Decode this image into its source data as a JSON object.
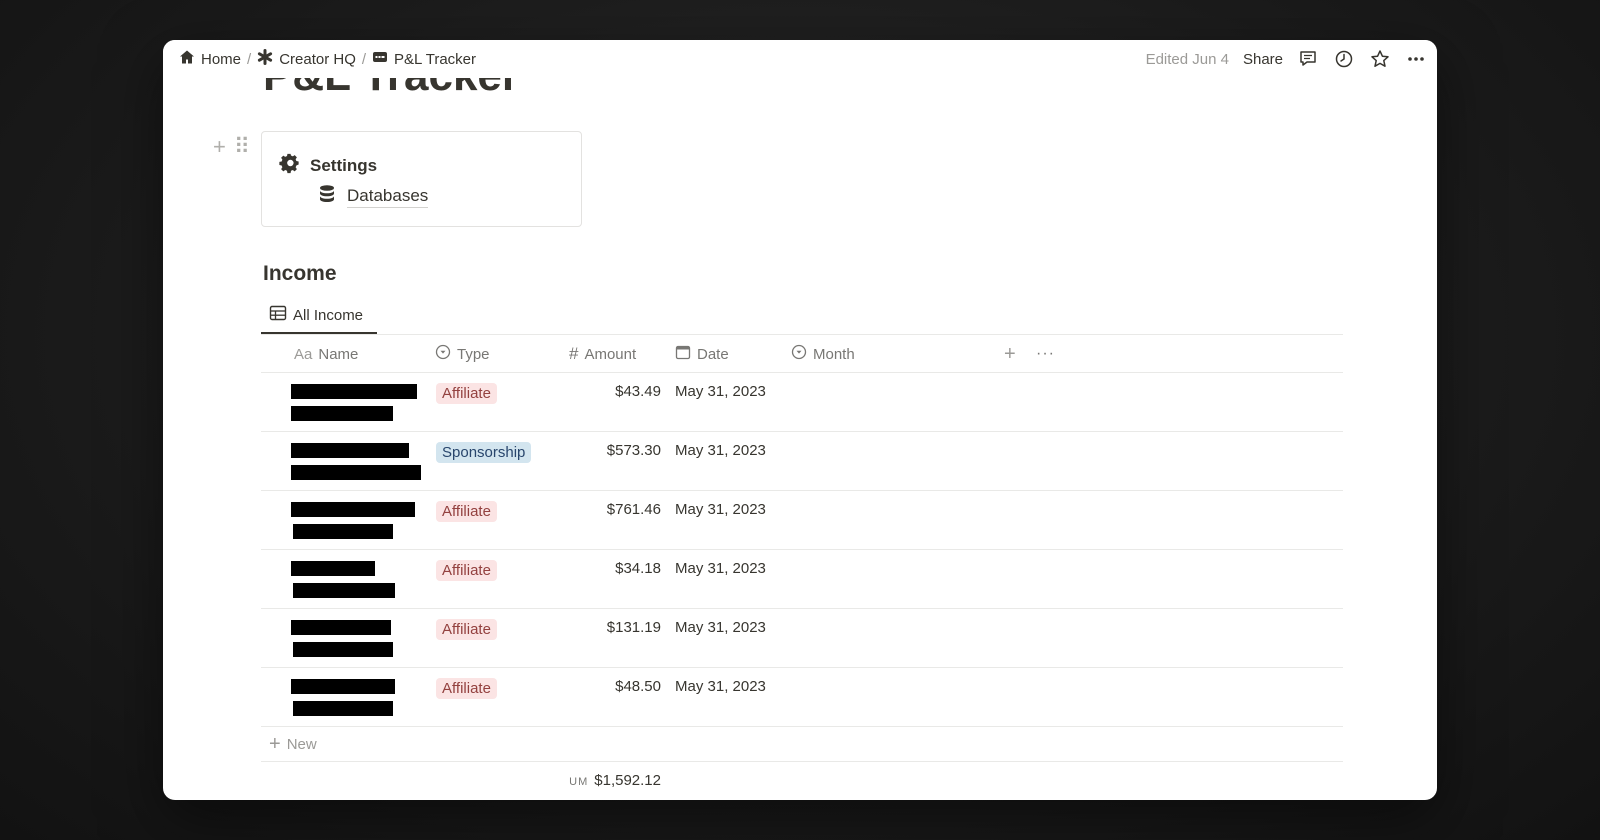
{
  "breadcrumb": {
    "items": [
      {
        "label": "Home",
        "icon": "home-icon"
      },
      {
        "label": "Creator HQ",
        "icon": "asterisk-icon"
      },
      {
        "label": "P&L Tracker",
        "icon": "id-card-icon"
      }
    ],
    "separator": "/"
  },
  "topbar": {
    "edited": "Edited Jun 4",
    "share": "Share",
    "icons": [
      "comment-icon",
      "clock-icon",
      "star-icon",
      "more-icon"
    ]
  },
  "page": {
    "title": "P&L Tracker"
  },
  "settings_card": {
    "title": "Settings",
    "link": "Databases"
  },
  "income": {
    "heading": "Income",
    "view_tab": "All Income",
    "columns": [
      {
        "label": "Name",
        "prefix": "Aa"
      },
      {
        "label": "Type",
        "icon": "select-icon"
      },
      {
        "label": "Amount",
        "prefix": "#"
      },
      {
        "label": "Date",
        "icon": "calendar-icon"
      },
      {
        "label": "Month",
        "icon": "select-icon"
      }
    ],
    "rows": [
      {
        "type": "Affiliate",
        "amount": "$43.49",
        "date": "May 31, 2023"
      },
      {
        "type": "Sponsorship",
        "amount": "$573.30",
        "date": "May 31, 2023"
      },
      {
        "type": "Affiliate",
        "amount": "$761.46",
        "date": "May 31, 2023"
      },
      {
        "type": "Affiliate",
        "amount": "$34.18",
        "date": "May 31, 2023"
      },
      {
        "type": "Affiliate",
        "amount": "$131.19",
        "date": "May 31, 2023"
      },
      {
        "type": "Affiliate",
        "amount": "$48.50",
        "date": "May 31, 2023"
      }
    ],
    "new_label": "New",
    "sum_label": "UM",
    "sum_value": "$1,592.12"
  },
  "colors": {
    "affiliate_bg": "#fbe4e4",
    "sponsorship_bg": "#d3e5ef",
    "text": "#37352f",
    "muted": "#9b9a97"
  }
}
